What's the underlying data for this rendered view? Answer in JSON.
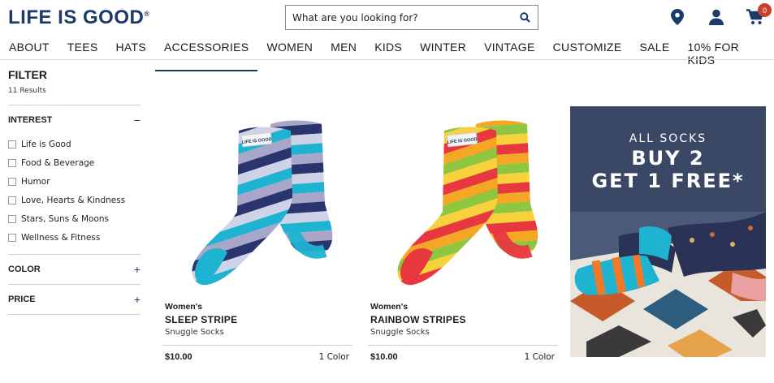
{
  "header": {
    "logo": "LIFE IS GOOD",
    "logo_mark": "®",
    "search_placeholder": "What are you looking for?",
    "cart_count": "0"
  },
  "nav": {
    "items": [
      "ABOUT",
      "TEES",
      "HATS",
      "ACCESSORIES",
      "WOMEN",
      "MEN",
      "KIDS",
      "WINTER",
      "VINTAGE",
      "CUSTOMIZE",
      "SALE",
      "10% FOR KIDS"
    ],
    "active": "ACCESSORIES"
  },
  "filter": {
    "title": "FILTER",
    "results": "11 Results",
    "sections": [
      {
        "label": "INTEREST",
        "toggle": "−",
        "options": [
          "Life is Good",
          "Food & Beverage",
          "Humor",
          "Love, Hearts & Kindness",
          "Stars, Suns & Moons",
          "Wellness & Fitness"
        ]
      },
      {
        "label": "COLOR",
        "toggle": "+"
      },
      {
        "label": "PRICE",
        "toggle": "+"
      }
    ]
  },
  "products": [
    {
      "kind": "Women's",
      "name": "SLEEP STRIPE",
      "sub": "Snuggle Socks",
      "price": "$10.00",
      "colors": "1 Color",
      "label": "LIFE IS GOOD",
      "stripe_colors": [
        "#1fb3d2",
        "#a9a6c9",
        "#2a356e",
        "#cfd3e8"
      ]
    },
    {
      "kind": "Women's",
      "name": "RAINBOW STRIPES",
      "sub": "Snuggle Socks",
      "price": "$10.00",
      "colors": "1 Color",
      "label": "LIFE IS GOOD",
      "stripe_colors": [
        "#e8383f",
        "#f5a623",
        "#8ec63f",
        "#f7d23a"
      ]
    }
  ],
  "promo": {
    "line1": "ALL SOCKS",
    "line2": "BUY 2",
    "line3": "GET 1 FREE*"
  },
  "colors": {
    "brand": "#1d3a6b",
    "badge": "#c8402d"
  }
}
